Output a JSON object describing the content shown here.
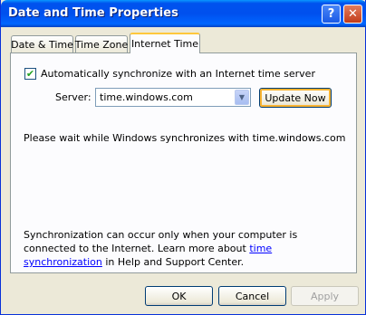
{
  "window": {
    "title": "Date and Time Properties"
  },
  "titlebar": {
    "help_icon": "?",
    "close_icon": "✕"
  },
  "tabs": [
    {
      "label": "Date & Time"
    },
    {
      "label": "Time Zone"
    },
    {
      "label": "Internet Time"
    }
  ],
  "active_tab": "Internet Time",
  "internet_time": {
    "auto_sync_checked": true,
    "checkmark": "✔",
    "auto_sync_label": "Automatically synchronize with an Internet time server",
    "server_label": "Server:",
    "server_value": "time.windows.com",
    "dropdown_arrow": "▼",
    "update_now_label": "Update Now",
    "status_text": "Please wait while Windows synchronizes with time.windows.com",
    "note_prefix": "Synchronization can occur only when your computer is connected to the Internet.  Learn more about ",
    "note_link": "time synchronization",
    "note_suffix": " in Help and Support Center."
  },
  "footer": {
    "ok_label": "OK",
    "cancel_label": "Cancel",
    "apply_label": "Apply"
  },
  "colors": {
    "titlebar": "#0054e3",
    "dialog_bg": "#ece9d8",
    "active_tab_accent": "#ffc83c",
    "link": "#0000ff"
  }
}
